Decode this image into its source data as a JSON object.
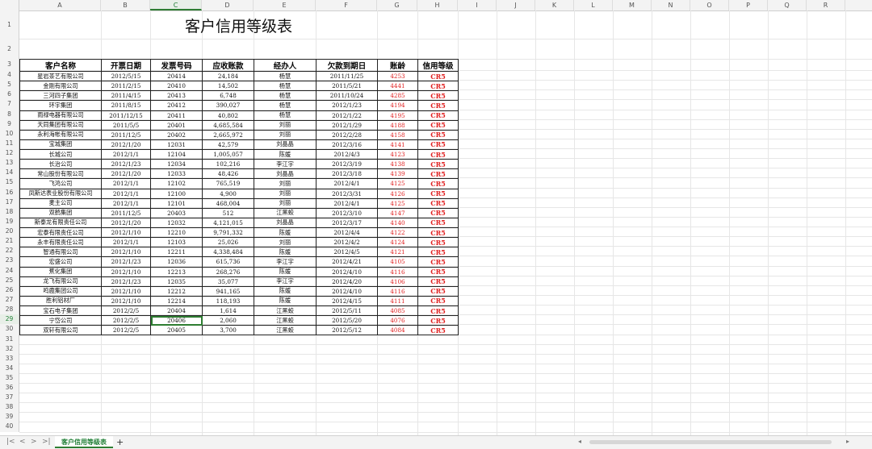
{
  "columns": [
    "A",
    "B",
    "C",
    "D",
    "E",
    "F",
    "G",
    "H",
    "I",
    "J",
    "K",
    "L",
    "M",
    "N",
    "O",
    "P",
    "Q",
    "R"
  ],
  "selected_column": "C",
  "selected_row": 29,
  "rows_visible": 40,
  "title": "客户信用等级表",
  "headers": [
    "客户名称",
    "开票日期",
    "发票号码",
    "应收账款",
    "经办人",
    "欠款到期日",
    "账龄",
    "信用等级"
  ],
  "records": [
    [
      "星岩茶艺有限公司",
      "2012/5/15",
      "20414",
      "24,184",
      "杨慧",
      "2011/11/25",
      "4253",
      "CR5"
    ],
    [
      "金刚有限公司",
      "2011/2/15",
      "20410",
      "14,502",
      "杨慧",
      "2011/5/21",
      "4441",
      "CR5"
    ],
    [
      "三河四子集团",
      "2011/4/15",
      "20413",
      "6,748",
      "杨慧",
      "2011/10/24",
      "4285",
      "CR5"
    ],
    [
      "环宇集团",
      "2011/8/15",
      "20412",
      "390,027",
      "杨慧",
      "2012/1/23",
      "4194",
      "CR5"
    ],
    [
      "雨禄电器有限公司",
      "2011/12/15",
      "20411",
      "40,802",
      "杨慧",
      "2012/1/22",
      "4195",
      "CR5"
    ],
    [
      "天同集团有限公司",
      "2011/5/5",
      "20401",
      "4,685,584",
      "刘丽",
      "2012/1/29",
      "4188",
      "CR5"
    ],
    [
      "永利海帐有限公司",
      "2011/12/5",
      "20402",
      "2,665,972",
      "刘丽",
      "2012/2/28",
      "4158",
      "CR5"
    ],
    [
      "宝城集团",
      "2012/1/20",
      "12031",
      "42,579",
      "刘晶晶",
      "2012/3/16",
      "4141",
      "CR5"
    ],
    [
      "长城公司",
      "2012/1/1",
      "12104",
      "1,005,057",
      "陈媛",
      "2012/4/3",
      "4123",
      "CR5"
    ],
    [
      "长治公司",
      "2012/1/23",
      "12034",
      "102,216",
      "李江宇",
      "2012/3/19",
      "4138",
      "CR5"
    ],
    [
      "常山股份有限公司",
      "2012/1/20",
      "12033",
      "48,426",
      "刘晶晶",
      "2012/3/18",
      "4139",
      "CR5"
    ],
    [
      "飞鸿公司",
      "2012/1/1",
      "12102",
      "765,519",
      "刘丽",
      "2012/4/1",
      "4125",
      "CR5"
    ],
    [
      "凤斯达表业股份有限公司",
      "2012/1/1",
      "12100",
      "4,900",
      "刘丽",
      "2012/3/31",
      "4126",
      "CR5"
    ],
    [
      "麦主公司",
      "2012/1/1",
      "12101",
      "468,004",
      "刘丽",
      "2012/4/1",
      "4125",
      "CR5"
    ],
    [
      "双鹤集团",
      "2011/12/5",
      "20403",
      "512",
      "江黑蛟",
      "2012/3/10",
      "4147",
      "CR5"
    ],
    [
      "斯泰龙有限责任公司",
      "2012/1/20",
      "12032",
      "4,121,015",
      "刘晶晶",
      "2012/3/17",
      "4140",
      "CR5"
    ],
    [
      "宏泰有限责任公司",
      "2012/1/10",
      "12210",
      "9,791,332",
      "陈媛",
      "2012/4/4",
      "4122",
      "CR5"
    ],
    [
      "永丰有限责任公司",
      "2012/1/1",
      "12103",
      "25,026",
      "刘丽",
      "2012/4/2",
      "4124",
      "CR5"
    ],
    [
      "智通有限公司",
      "2012/1/10",
      "12211",
      "4,338,484",
      "陈媛",
      "2012/4/5",
      "4121",
      "CR5"
    ],
    [
      "宏盛公司",
      "2012/1/23",
      "12036",
      "615,736",
      "李江宇",
      "2012/4/21",
      "4105",
      "CR5"
    ],
    [
      "蕉化集团",
      "2012/1/10",
      "12213",
      "268,276",
      "陈媛",
      "2012/4/10",
      "4116",
      "CR5"
    ],
    [
      "龙飞有限公司",
      "2012/1/23",
      "12035",
      "35,077",
      "李江宇",
      "2012/4/20",
      "4106",
      "CR5"
    ],
    [
      "鸣鹿集团公司",
      "2012/1/10",
      "12212",
      "941,165",
      "陈媛",
      "2012/4/10",
      "4116",
      "CR5"
    ],
    [
      "胜利铝材厂",
      "2012/1/10",
      "12214",
      "118,193",
      "陈媛",
      "2012/4/15",
      "4111",
      "CR5"
    ],
    [
      "宝石电子集团",
      "2012/2/5",
      "20404",
      "1,614",
      "江黑蛟",
      "2012/5/11",
      "4085",
      "CR5"
    ],
    [
      "宁岱公司",
      "2012/2/5",
      "20406",
      "2,060",
      "江黑蛟",
      "2012/5/20",
      "4076",
      "CR5"
    ],
    [
      "双轩有限公司",
      "2012/2/5",
      "20405",
      "3,700",
      "江黑蛟",
      "2012/5/12",
      "4084",
      "CR5"
    ]
  ],
  "sheet_tab": "客户信用等级表",
  "nav_icons": [
    "first-sheet-icon",
    "prev-sheet-icon",
    "next-sheet-icon",
    "last-sheet-icon"
  ],
  "add_sheet_label": "+",
  "colors": {
    "accent": "#2e7d32",
    "red": "#e02020"
  }
}
